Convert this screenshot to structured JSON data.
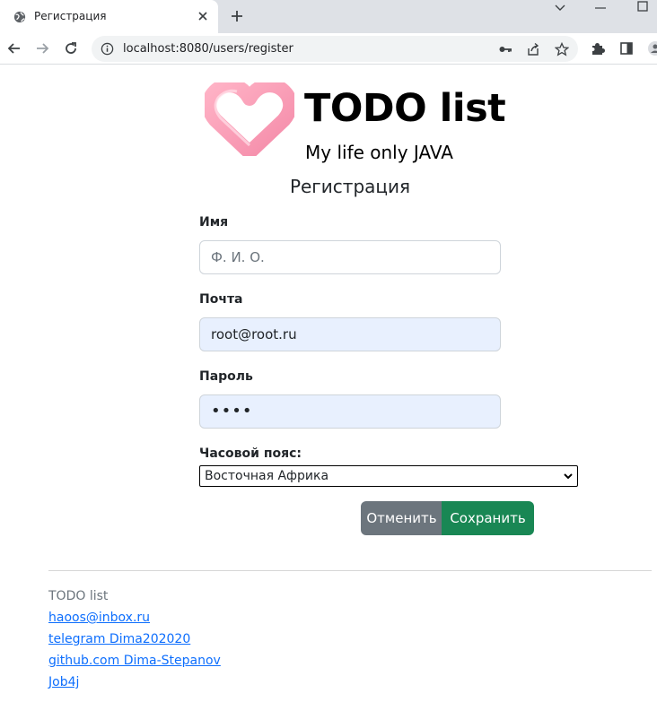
{
  "browser": {
    "tab_title": "Регистрация",
    "url": "localhost:8080/users/register"
  },
  "header": {
    "title": "TODO list",
    "subtitle": "My life only JAVA"
  },
  "form": {
    "title": "Регистрация",
    "name_label": "Имя",
    "name_placeholder": "Ф. И. О.",
    "email_label": "Почта",
    "email_value": "root@root.ru",
    "password_label": "Пароль",
    "password_value": "••••",
    "timezone_label": "Часовой пояс:",
    "timezone_selected": "Восточная Африка",
    "cancel_label": "Отменить",
    "save_label": "Сохранить"
  },
  "footer": {
    "brand": "TODO list",
    "links": [
      "haoos@inbox.ru",
      "telegram Dima202020",
      "github.com Dima-Stepanov",
      "Job4j"
    ]
  },
  "colors": {
    "cancel": "#6c757d",
    "save": "#198754",
    "link": "#0d6efd",
    "autofill": "#e8f0fe"
  }
}
